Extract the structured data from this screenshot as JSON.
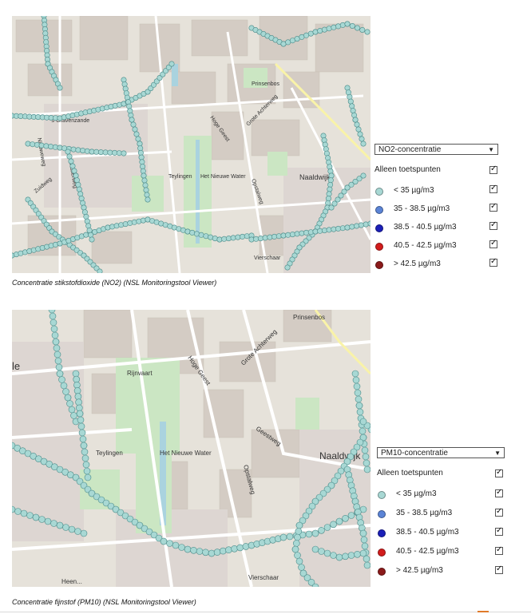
{
  "map1": {
    "caption": "Concentratie stikstofdioxide (NO2) (NSL Monitoringstool Viewer)",
    "labels": [
      "'s-Gravenzande",
      "Naaldwijk",
      "Teylingen",
      "Het Nieuwe Water",
      "Prinsenbos",
      "Hoge Geest",
      "Grote Achterweg",
      "Opstalweg",
      "Vierschaar",
      "Zuidweg",
      "Nieuweweg",
      "Ruiterweg"
    ],
    "dropdown": "NO2-concentratie",
    "only_test_points": "Alleen toetspunten",
    "legend": [
      {
        "label": "< 35 µg/m3",
        "color": "#a8d8d4"
      },
      {
        "label": "35 - 38.5 µg/m3",
        "color": "#5b84d6"
      },
      {
        "label": "38.5 - 40.5 µg/m3",
        "color": "#1b1fb8"
      },
      {
        "label": "40.5 - 42.5 µg/m3",
        "color": "#d21c1c"
      },
      {
        "label": "> 42.5 µg/m3",
        "color": "#8b1a1a"
      }
    ]
  },
  "map2": {
    "caption": "Concentratie fijnstof (PM10) (NSL Monitoringstool Viewer)",
    "labels": [
      "le",
      "Prinsenbos",
      "Hoge Geest",
      "Grote Achterweg",
      "Rijnvaart",
      "Teylingen",
      "Het Nieuwe Water",
      "Naaldwijk",
      "Opstalweg",
      "Geestweg",
      "Vierschaar",
      "Heen..."
    ],
    "dropdown": "PM10-concentratie",
    "only_test_points": "Alleen toetspunten",
    "legend": [
      {
        "label": "< 35 µg/m3",
        "color": "#a8d8d4"
      },
      {
        "label": "35 - 38.5 µg/m3",
        "color": "#5b84d6"
      },
      {
        "label": "38.5 - 40.5 µg/m3",
        "color": "#1b1fb8"
      },
      {
        "label": "40.5 - 42.5 µg/m3",
        "color": "#d21c1c"
      },
      {
        "label": "> 42.5 µg/m3",
        "color": "#8b1a1a"
      }
    ]
  },
  "marker_color": "#a8d8d4"
}
